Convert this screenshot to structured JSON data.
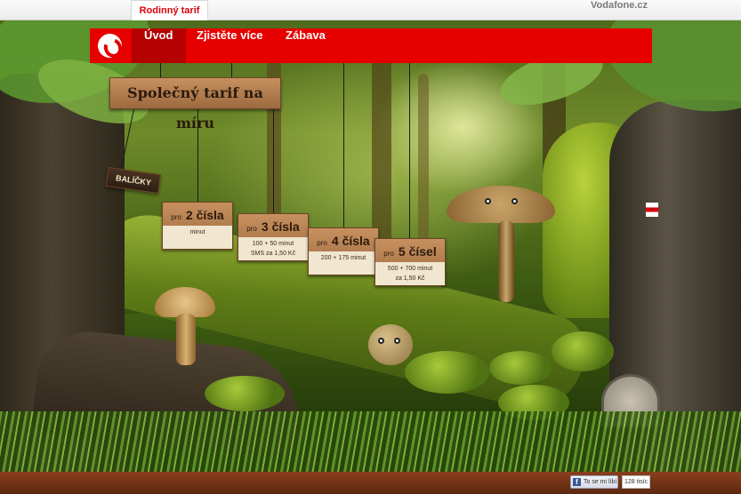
{
  "topbar": {
    "active_tab": "Rodinný tarif",
    "brand_link": "Vodafone.cz"
  },
  "nav": {
    "items": [
      "Úvod",
      "Zjistěte více",
      "Zábava"
    ],
    "active_index": 0,
    "accent_color": "#e60000"
  },
  "signs": {
    "main": "Společný tarif na míru",
    "packages": "BALÍČKY",
    "plans": [
      {
        "prefix": "pro",
        "title": "2 čísla",
        "line1": "minut",
        "line2": ""
      },
      {
        "prefix": "pro",
        "title": "3 čísla",
        "line1": "100 + 50 minut",
        "line2": "SMS za 1,50 Kč"
      },
      {
        "prefix": "pro",
        "title": "4 čísla",
        "line1": "200 + 175 minut",
        "line2": ""
      },
      {
        "prefix": "pro",
        "title": "5 čísel",
        "line1": "500 + 700 minut",
        "line2": "za 1,50 Kč"
      }
    ]
  },
  "footer": {
    "like_label": "To se mi líbí",
    "like_count": "128 tisíc"
  },
  "icons": [
    "vodafone-logo-icon",
    "facebook-icon"
  ]
}
